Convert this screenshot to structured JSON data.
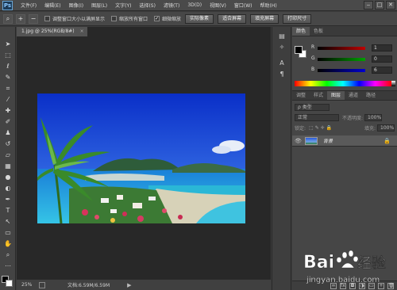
{
  "app": {
    "logo": "Ps"
  },
  "menu": [
    "文件(F)",
    "编辑(E)",
    "图像(I)",
    "图层(L)",
    "文字(Y)",
    "选择(S)",
    "滤镜(T)",
    "3D(D)",
    "视图(V)",
    "窗口(W)",
    "帮助(H)"
  ],
  "window_buttons": [
    "‒",
    "□",
    "✕"
  ],
  "options": {
    "check1": "调整窗口大小以满屏显示",
    "check2": "缩放所有窗口",
    "check3": "细微缩放",
    "check3_checked": true,
    "btn1": "实际像素",
    "btn2": "适合屏幕",
    "btn3": "填充屏幕",
    "btn4": "打印尺寸"
  },
  "document": {
    "tab_title": "1.jpg @ 25%(RGB/8#)",
    "tab_close": "×",
    "zoom": "25%",
    "info": "文档:6.59M/6.59M"
  },
  "color_panel": {
    "tabs": [
      "颜色",
      "色板"
    ],
    "r_label": "R",
    "r_value": "1",
    "g_label": "G",
    "g_value": "0",
    "b_label": "B",
    "b_value": "6"
  },
  "layers_panel": {
    "tabs": [
      "调整",
      "样式",
      "图层",
      "通道",
      "路径"
    ],
    "filter_kind": "ρ 类型",
    "blend_mode": "正常",
    "opacity_label": "不透明度:",
    "opacity_value": "100%",
    "lock_label": "锁定:",
    "fill_label": "填充:",
    "fill_value": "100%",
    "layer_name": "背景"
  },
  "watermark": {
    "brand": "Bai",
    "brand2": "经验",
    "url": "jingyan.baidu.com"
  },
  "colors": {
    "accent": "#1d3b57",
    "r_slider": "#c00000",
    "g_slider": "#00a000",
    "b_slider": "#0000d0"
  }
}
